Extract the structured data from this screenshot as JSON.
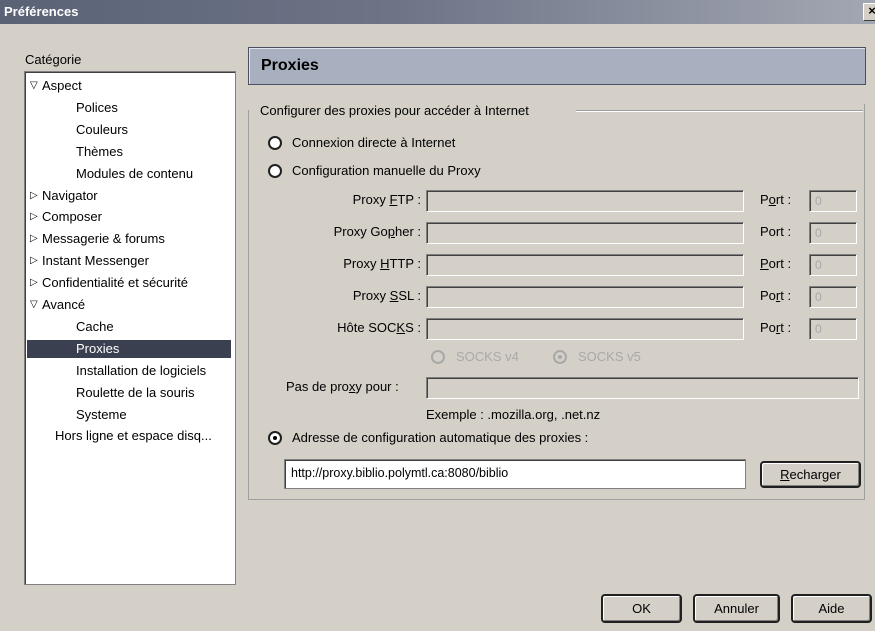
{
  "window": {
    "title": "Préférences",
    "close_glyph": "×"
  },
  "category_label": "Catégorie",
  "tree": [
    {
      "label": "Aspect",
      "twisty": "▽",
      "level": 0
    },
    {
      "label": "Polices",
      "level": 1
    },
    {
      "label": "Couleurs",
      "level": 1
    },
    {
      "label": "Thèmes",
      "level": 1
    },
    {
      "label": "Modules de contenu",
      "level": 1
    },
    {
      "label": "Navigator",
      "twisty": "▷",
      "level": 0
    },
    {
      "label": "Composer",
      "twisty": "▷",
      "level": 0
    },
    {
      "label": "Messagerie & forums",
      "twisty": "▷",
      "level": 0
    },
    {
      "label": "Instant Messenger",
      "twisty": "▷",
      "level": 0
    },
    {
      "label": "Confidentialité et sécurité",
      "twisty": "▷",
      "level": 0
    },
    {
      "label": "Avancé",
      "twisty": "▽",
      "level": 0
    },
    {
      "label": "Cache",
      "level": 1
    },
    {
      "label": "Proxies",
      "level": 1,
      "selected": true
    },
    {
      "label": "Installation de logiciels",
      "level": 1
    },
    {
      "label": "Roulette de la souris",
      "level": 1
    },
    {
      "label": "Systeme",
      "level": 1
    },
    {
      "label": "Hors ligne et espace disq...",
      "level": 0.5
    }
  ],
  "panel": {
    "title": "Proxies",
    "group_title": "Configurer des proxies pour accéder à Internet",
    "radio_direct": "Connexion directe à Internet",
    "radio_manual": "Configuration manuelle du Proxy",
    "proxy_rows": [
      {
        "label_pre": "Proxy ",
        "label_u": "F",
        "label_post": "TP :",
        "port_pre": "P",
        "port_u": "o",
        "port_post": "rt :",
        "port_value": "0"
      },
      {
        "label_pre": "Proxy Go",
        "label_u": "p",
        "label_post": "her :",
        "port_pre": "Port :",
        "port_u": "",
        "port_post": "",
        "port_value": "0"
      },
      {
        "label_pre": "Proxy ",
        "label_u": "H",
        "label_post": "TTP :",
        "port_pre": "",
        "port_u": "P",
        "port_post": "ort :",
        "port_value": "0"
      },
      {
        "label_pre": "Proxy ",
        "label_u": "S",
        "label_post": "SL :",
        "port_pre": "Po",
        "port_u": "r",
        "port_post": "t :",
        "port_value": "0"
      },
      {
        "label_pre": "Hôte SOC",
        "label_u": "K",
        "label_post": "S :",
        "port_pre": "Po",
        "port_u": "r",
        "port_post": "t :",
        "port_value": "0"
      }
    ],
    "socks_v4": "SOCKS v4",
    "socks_v5": "SOCKS v5",
    "no_proxy_pre": "Pas de pro",
    "no_proxy_u": "x",
    "no_proxy_post": "y pour :",
    "example": "Exemple : .mozilla.org, .net.nz",
    "radio_auto": "Adresse de configuration automatique des proxies :",
    "auto_url": "http://proxy.biblio.polymtl.ca:8080/biblio",
    "reload_pre": "",
    "reload_u": "R",
    "reload_post": "echarger"
  },
  "buttons": {
    "ok": "OK",
    "cancel": "Annuler",
    "help": "Aide"
  }
}
